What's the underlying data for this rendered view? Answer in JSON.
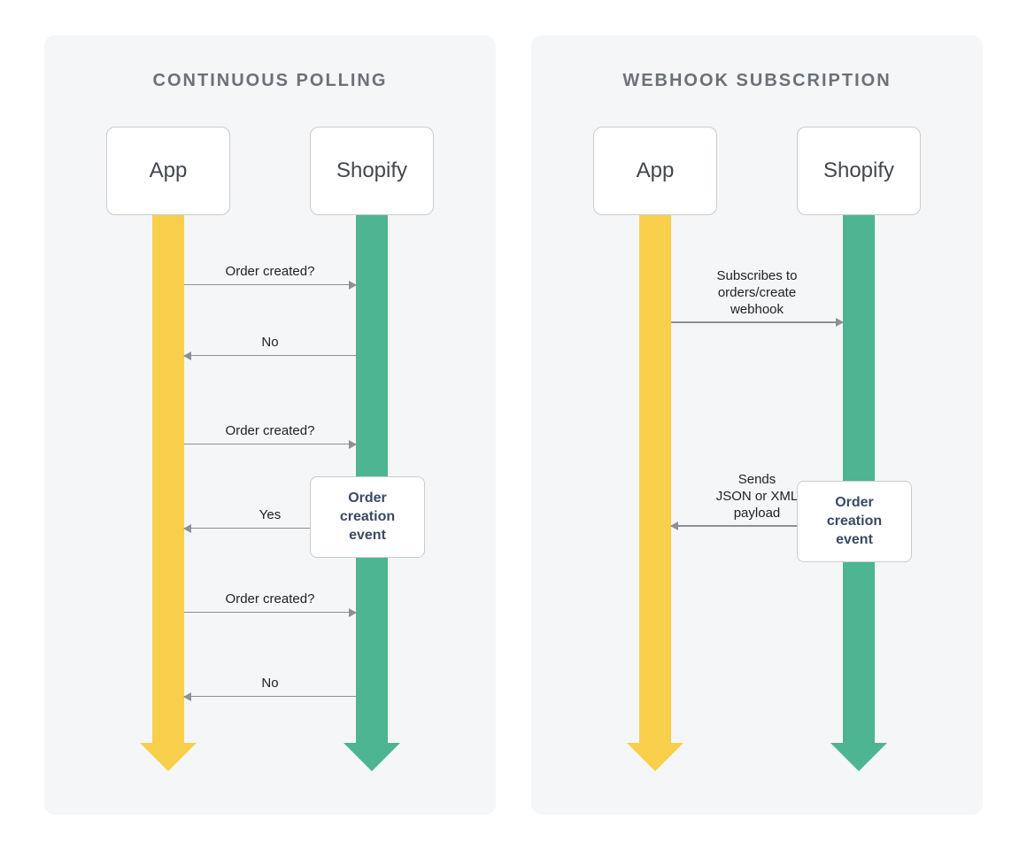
{
  "left": {
    "title": "CONTINUOUS POLLING",
    "entities": {
      "app": "App",
      "shopify": "Shopify"
    },
    "messages": {
      "m1": "Order created?",
      "m2": "No",
      "m3": "Order created?",
      "m4": "Yes",
      "m5": "Order created?",
      "m6": "No"
    },
    "event": "Order creation event"
  },
  "right": {
    "title": "WEBHOOK SUBSCRIPTION",
    "entities": {
      "app": "App",
      "shopify": "Shopify"
    },
    "messages": {
      "m1": "Subscribes to\norders/create\nwebhook",
      "m2": "Sends\nJSON or XML\npayload"
    },
    "event": "Order creation event"
  },
  "colors": {
    "app_timeline": "#f8cf4a",
    "shopify_timeline": "#4db591",
    "panel_bg": "#f4f6f8",
    "title_text": "#6b7177",
    "arrow": "#8c9196"
  }
}
